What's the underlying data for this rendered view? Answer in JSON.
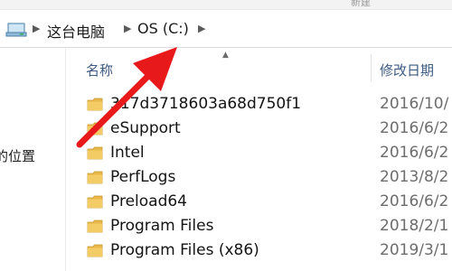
{
  "ribbon": {
    "partial_label": "新建"
  },
  "breadcrumb": {
    "items": [
      {
        "label": "这台电脑"
      },
      {
        "label": "OS (C:)"
      }
    ]
  },
  "navigation_pane": {
    "partial_label": "的位置"
  },
  "columns": {
    "name": "名称",
    "date_modified": "修改日期"
  },
  "files": [
    {
      "name": "317d3718603a68d750f1",
      "date": "2016/10/"
    },
    {
      "name": "eSupport",
      "date": "2016/6/2"
    },
    {
      "name": "Intel",
      "date": "2016/6/2"
    },
    {
      "name": "PerfLogs",
      "date": "2013/8/2"
    },
    {
      "name": "Preload64",
      "date": "2016/6/2"
    },
    {
      "name": "Program Files",
      "date": "2018/2/1"
    },
    {
      "name": "Program Files (x86)",
      "date": "2019/3/1"
    }
  ],
  "colors": {
    "annotation_arrow": "#e8191b",
    "folder": "#e8b84a",
    "header_text": "#3c5a82"
  },
  "icons": {
    "computer": "this-pc-icon",
    "folder": "folder-icon",
    "sort": "sort-ascending-icon",
    "separator": "chevron-right-icon"
  }
}
